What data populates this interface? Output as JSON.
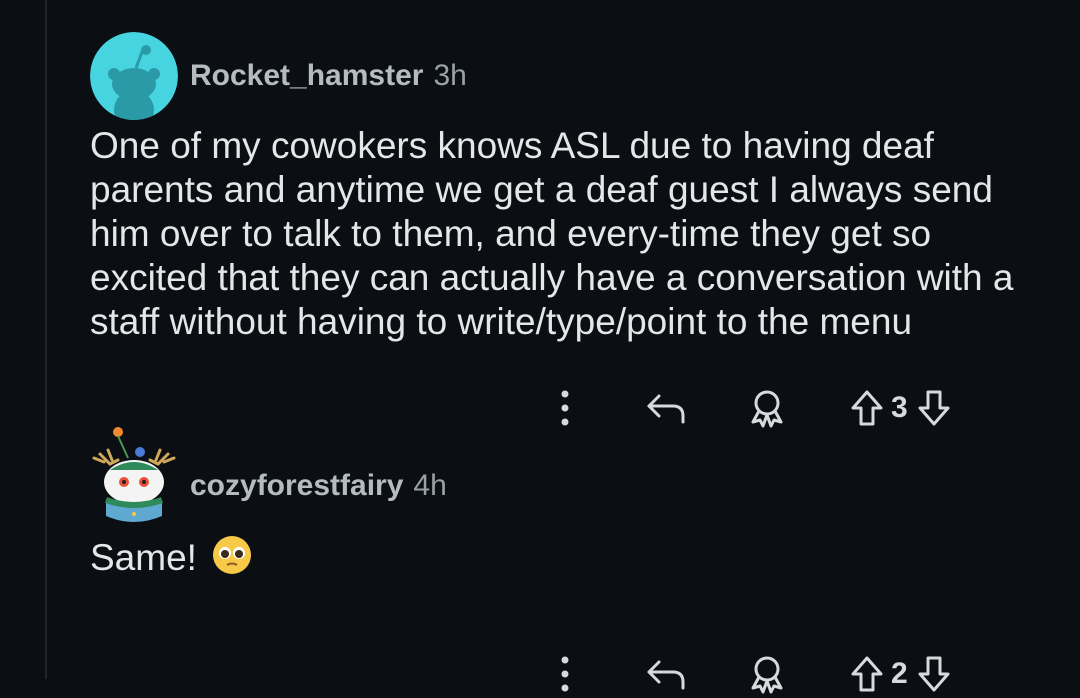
{
  "comments": [
    {
      "username": "Rocket_hamster",
      "time": "3h",
      "body": "One of my cowokers knows ASL due to having deaf parents and anytime we get a deaf guest I always send him over to talk to them, and every-time they get so excited that they can actually have a conversation with a staff without having to write/type/point to the menu",
      "score": "3",
      "avatar": "default-snoo-avatar",
      "avatar_color": "#46d4e0"
    },
    {
      "username": "cozyforestfairy",
      "time": "4h",
      "body": "Same!",
      "emoji": "pleading-face-emoji",
      "score": "2",
      "avatar": "forest-creature-avatar"
    }
  ],
  "icons": {
    "more": "vertical-dots-icon",
    "reply": "reply-arrow-icon",
    "award": "award-icon",
    "upvote": "upvote-arrow-icon",
    "downvote": "downvote-arrow-icon"
  },
  "colors": {
    "background": "#0b0e12",
    "text": "#e4e6e8",
    "username": "#b5bcc1"
  }
}
